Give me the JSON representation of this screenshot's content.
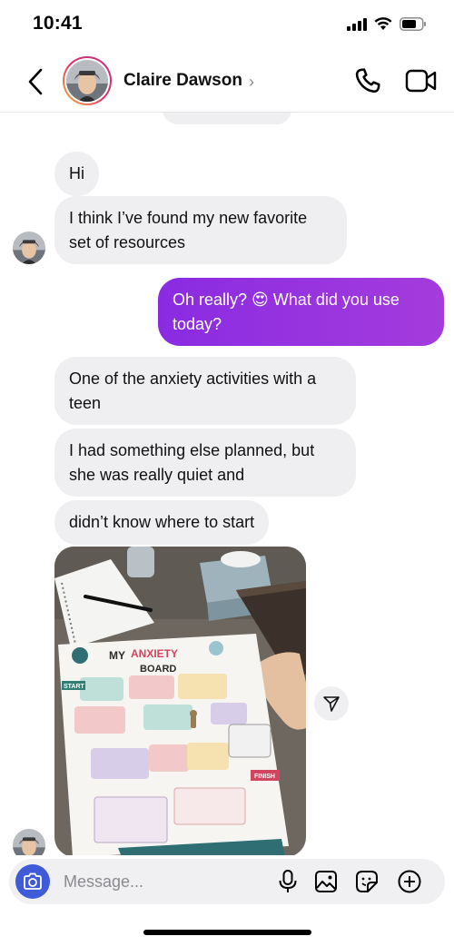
{
  "status_bar": {
    "time": "10:41"
  },
  "header": {
    "contact_name": "Claire Dawson",
    "chevron": "›",
    "back_icon": "chevron-left-icon",
    "call_icon": "phone-icon",
    "video_icon": "video-camera-icon"
  },
  "messages": [
    {
      "direction": "incoming",
      "text": "Hi"
    },
    {
      "direction": "incoming",
      "text": "I think I’ve found my new favorite set of resources"
    },
    {
      "direction": "outgoing",
      "text": "Oh really? 😍 What did you use today?"
    },
    {
      "direction": "incoming",
      "text": "One of the anxiety activities with a teen"
    },
    {
      "direction": "incoming",
      "text": "I had something else planned, but she was really quiet and"
    },
    {
      "direction": "incoming",
      "text": "didn’t know where to start"
    },
    {
      "direction": "incoming",
      "type": "photo",
      "board_title_1": "MY",
      "board_title_2": "ANXIETY",
      "board_title_3": "BOARD",
      "start_label": "START",
      "finish_label": "FINISH"
    }
  ],
  "composer": {
    "placeholder": "Message...",
    "camera_icon": "camera-icon",
    "mic_icon": "microphone-icon",
    "gallery_icon": "image-icon",
    "sticker_icon": "sticker-icon",
    "add_icon": "plus-circle-icon"
  },
  "colors": {
    "outgoing_bubble": "#9333ea",
    "incoming_bubble": "#efeff1",
    "camera_button": "#3f5bd8"
  }
}
